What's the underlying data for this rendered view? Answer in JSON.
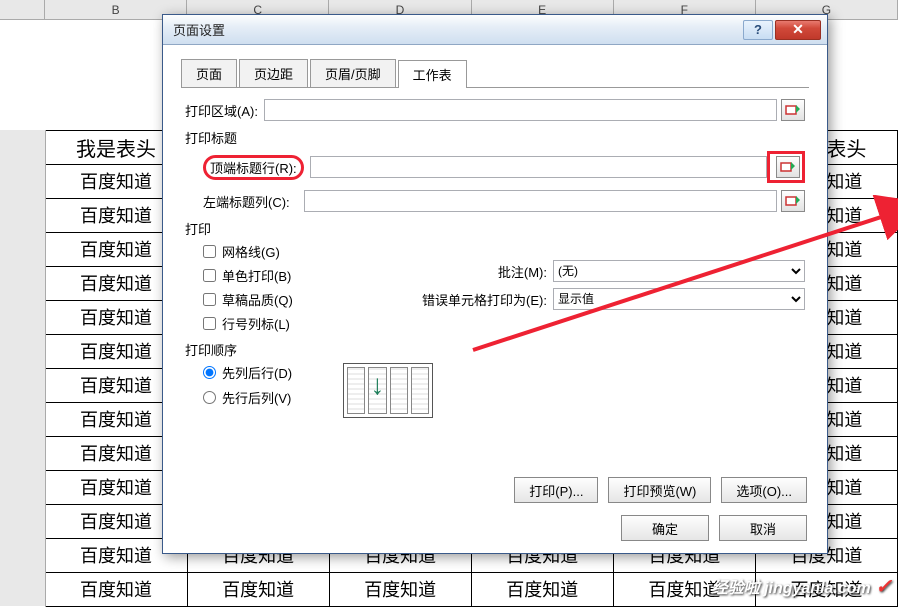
{
  "columns": [
    "B",
    "C",
    "D",
    "E",
    "F",
    "G"
  ],
  "sheet": {
    "header_text": "我是表头",
    "cell_text": "百度知道"
  },
  "dialog": {
    "title": "页面设置",
    "tabs": [
      "页面",
      "页边距",
      "页眉/页脚",
      "工作表"
    ],
    "active_tab": 3,
    "print_area_label": "打印区域(A):",
    "print_titles_label": "打印标题",
    "top_rows_label": "顶端标题行(R):",
    "left_cols_label": "左端标题列(C):",
    "print_label": "打印",
    "checks": {
      "gridlines": "网格线(G)",
      "mono": "单色打印(B)",
      "draft": "草稿品质(Q)",
      "rowcol": "行号列标(L)"
    },
    "comment_label": "批注(M):",
    "comment_value": "(无)",
    "error_label": "错误单元格打印为(E):",
    "error_value": "显示值",
    "order_label": "打印顺序",
    "order_opts": {
      "colrow": "先列后行(D)",
      "rowcol": "先行后列(V)"
    },
    "buttons": {
      "print": "打印(P)...",
      "preview": "打印预览(W)",
      "options": "选项(O)...",
      "ok": "确定",
      "cancel": "取消"
    }
  },
  "watermark": "经验啦 jingyanla.com"
}
